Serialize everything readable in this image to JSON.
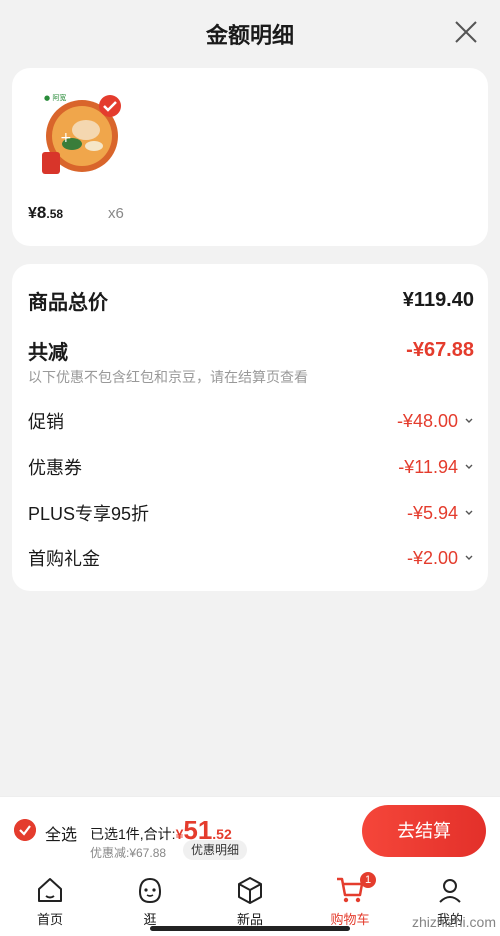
{
  "header": {
    "title": "金额明细"
  },
  "product": {
    "price_yen": "¥",
    "price_int": "8",
    "price_dec": ".58",
    "quantity": "x6"
  },
  "summary": {
    "total_label": "商品总价",
    "total_value": "¥119.40",
    "reduce_label": "共减",
    "reduce_value": "-¥67.88",
    "note": "以下优惠不包含红包和京豆，请在结算页查看",
    "items": [
      {
        "label": "促销",
        "value": "-¥48.00"
      },
      {
        "label": "优惠券",
        "value": "-¥11.94"
      },
      {
        "label": "PLUS专享95折",
        "value": "-¥5.94"
      },
      {
        "label": "首购礼金",
        "value": "-¥2.00"
      }
    ]
  },
  "checkout": {
    "select_all": "全选",
    "selected_text": "已选1件,合计:",
    "sum_yen": "¥",
    "sum_int": "51",
    "sum_dec": ".52",
    "saved_text": "优惠减:¥67.88",
    "detail_label": "优惠明细",
    "button_label": "去结算"
  },
  "tabbar": {
    "tabs": [
      {
        "label": "首页",
        "icon": "home-icon"
      },
      {
        "label": "逛",
        "icon": "face-icon"
      },
      {
        "label": "新品",
        "icon": "box-icon"
      },
      {
        "label": "购物车",
        "icon": "cart-icon"
      },
      {
        "label": "我的",
        "icon": "user-icon"
      }
    ],
    "cart_badge": "1"
  },
  "colors": {
    "accent": "#e43c2d",
    "background": "#f2f2f2"
  },
  "watermark": "zhizhizhi.com"
}
